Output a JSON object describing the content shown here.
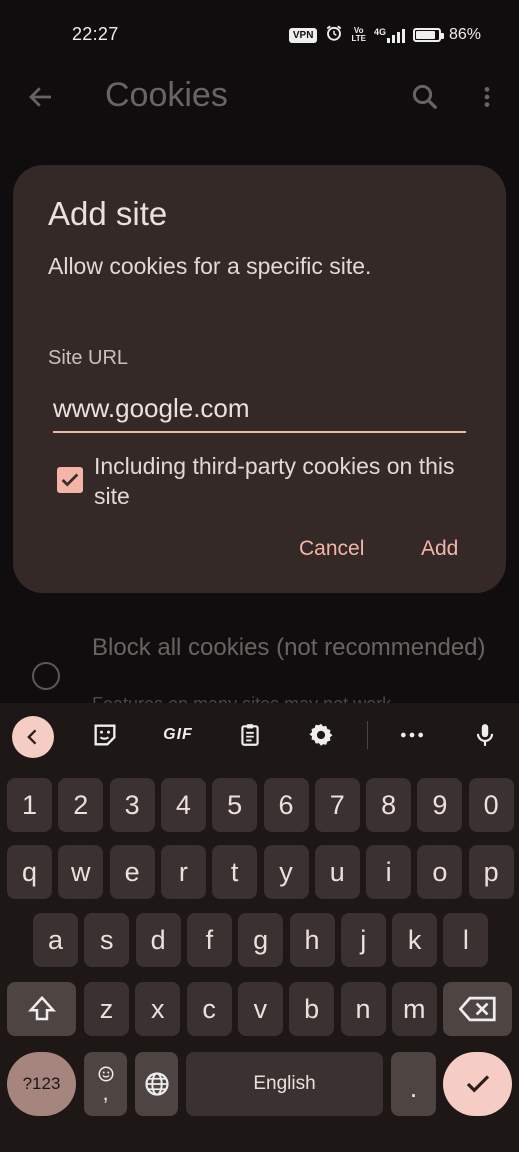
{
  "status_bar": {
    "time": "22:27",
    "vpn": "VPN",
    "volte_top": "Vo",
    "volte_bottom": "LTE",
    "network": "4G",
    "battery_text": "86%",
    "battery_level": 0.86
  },
  "app_bar": {
    "title": "Cookies"
  },
  "background_list": {
    "option_label": "Block all cookies (not recommended)",
    "option_sub": "Features on many sites may not work"
  },
  "dialog": {
    "title": "Add site",
    "description": "Allow cookies for a specific site.",
    "field_label": "Site URL",
    "url_value": "www.google.com",
    "checkbox_label": "Including third-party cookies on this site",
    "checkbox_checked": true,
    "cancel_label": "Cancel",
    "add_label": "Add"
  },
  "keyboard": {
    "toolbar": {
      "gif_label": "GIF"
    },
    "number_row": [
      "1",
      "2",
      "3",
      "4",
      "5",
      "6",
      "7",
      "8",
      "9",
      "0"
    ],
    "row1": [
      "q",
      "w",
      "e",
      "r",
      "t",
      "y",
      "u",
      "i",
      "o",
      "p"
    ],
    "row2": [
      "a",
      "s",
      "d",
      "f",
      "g",
      "h",
      "j",
      "k",
      "l"
    ],
    "row3": [
      "z",
      "x",
      "c",
      "v",
      "b",
      "n",
      "m"
    ],
    "symbols_label": "?123",
    "comma_label": ",",
    "space_label": "English",
    "period_label": ".",
    "accent_color": "#f2b5a7",
    "key_color": "#3a3130"
  }
}
